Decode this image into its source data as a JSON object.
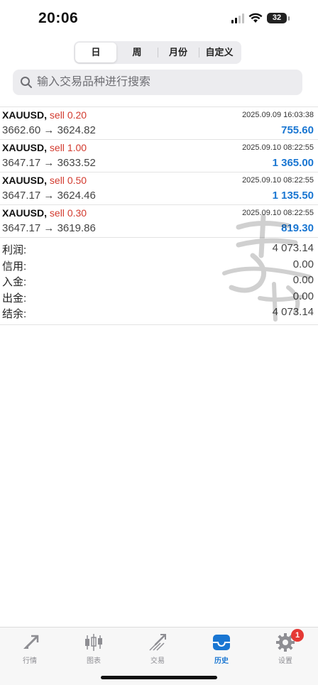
{
  "status_bar": {
    "time": "20:06",
    "battery": "32"
  },
  "period_tabs": [
    {
      "label": "日",
      "active": true
    },
    {
      "label": "周",
      "active": false
    },
    {
      "label": "月份",
      "active": false
    },
    {
      "label": "自定义",
      "active": false
    }
  ],
  "search": {
    "placeholder": "输入交易品种进行搜索"
  },
  "deals": [
    {
      "symbol": "XAUUSD,",
      "side": "sell",
      "volume": "0.20",
      "datetime": "2025.09.09 16:03:38",
      "open_price": "3662.60",
      "arrow": "→",
      "close_price": "3624.82",
      "profit": "755.60"
    },
    {
      "symbol": "XAUUSD,",
      "side": "sell",
      "volume": "1.00",
      "datetime": "2025.09.10 08:22:55",
      "open_price": "3647.17",
      "arrow": "→",
      "close_price": "3633.52",
      "profit": "1 365.00"
    },
    {
      "symbol": "XAUUSD,",
      "side": "sell",
      "volume": "0.50",
      "datetime": "2025.09.10 08:22:55",
      "open_price": "3647.17",
      "arrow": "→",
      "close_price": "3624.46",
      "profit": "1 135.50"
    },
    {
      "symbol": "XAUUSD,",
      "side": "sell",
      "volume": "0.30",
      "datetime": "2025.09.10 08:22:55",
      "open_price": "3647.17",
      "arrow": "→",
      "close_price": "3619.86",
      "profit": "819.30"
    }
  ],
  "summary": [
    {
      "label": "利润:",
      "value": "4 073.14"
    },
    {
      "label": "信用:",
      "value": "0.00"
    },
    {
      "label": "入金:",
      "value": "0.00"
    },
    {
      "label": "出金:",
      "value": "0.00"
    },
    {
      "label": "结余:",
      "value": "4 073.14"
    }
  ],
  "tab_bar": {
    "items": [
      {
        "label": "行情",
        "icon": "quotes-icon",
        "active": false
      },
      {
        "label": "图表",
        "icon": "candlestick-chart-icon",
        "active": false
      },
      {
        "label": "交易",
        "icon": "trade-icon",
        "active": false
      },
      {
        "label": "历史",
        "icon": "history-inbox-icon",
        "active": true
      },
      {
        "label": "设置",
        "icon": "gear-icon",
        "active": false,
        "badge": "1"
      }
    ]
  },
  "colors": {
    "sell": "#d23a2e",
    "profit": "#1976d2",
    "active_tab": "#1976d2",
    "badge": "#e53935"
  }
}
